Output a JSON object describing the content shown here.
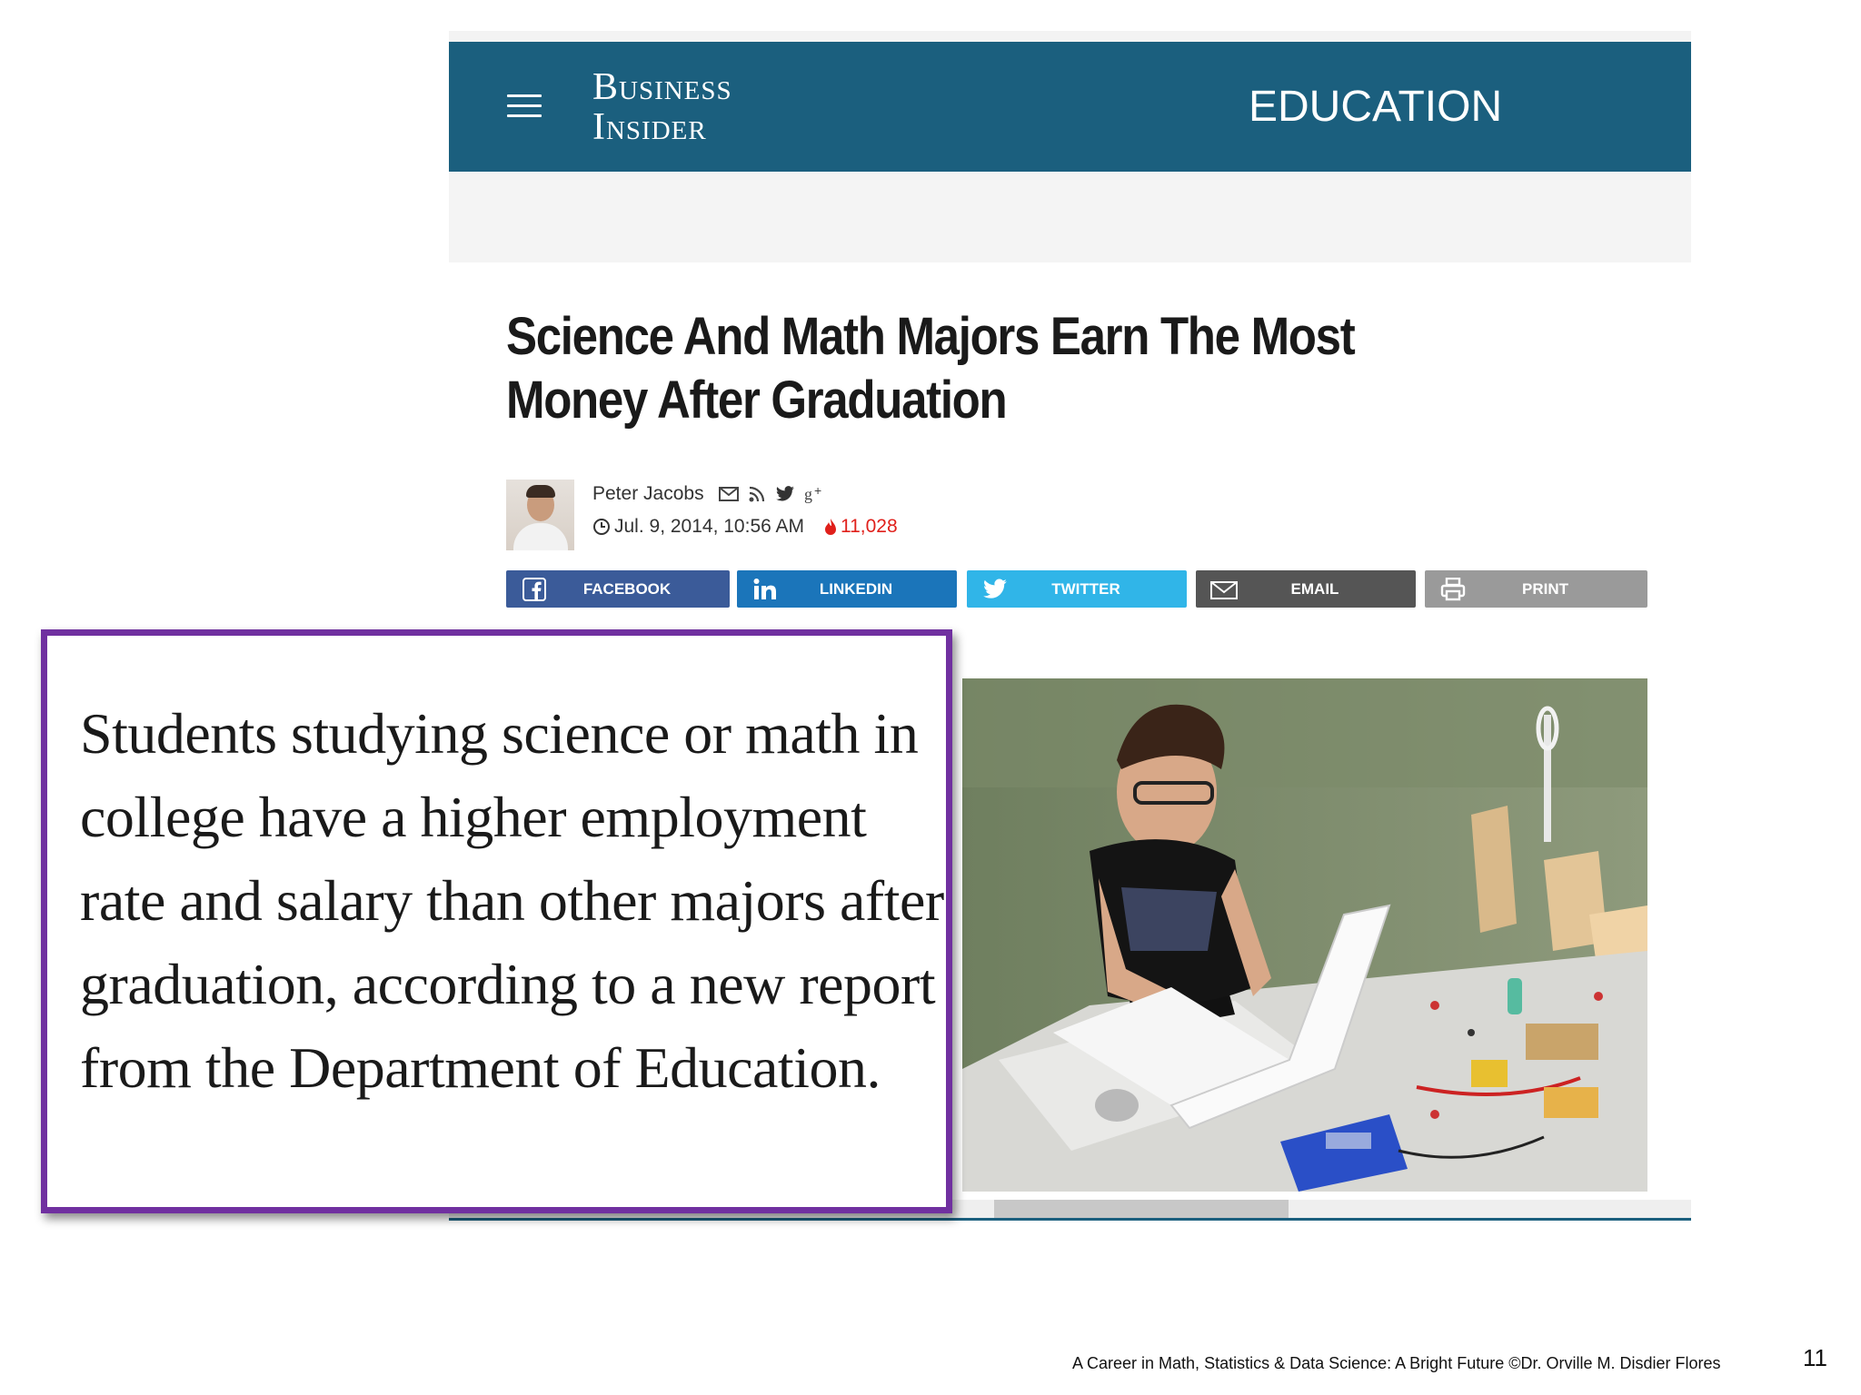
{
  "header": {
    "logo_line1": "Business",
    "logo_line2": "Insider",
    "section": "EDUCATION"
  },
  "article": {
    "title": "Science And Math Majors Earn The Most Money After Graduation",
    "author": "Peter Jacobs",
    "date": "Jul. 9, 2014, 10:56 AM",
    "views": "11,028"
  },
  "share": {
    "facebook": "FACEBOOK",
    "linkedin": "LINKEDIN",
    "twitter": "TWITTER",
    "email": "EMAIL",
    "print": "PRINT"
  },
  "quote": {
    "text": "Students studying science or math in college have a higher employment rate and salary than other majors after graduation, according to a new report from the Department of Education."
  },
  "slide": {
    "footer": "A Career in Math, Statistics & Data Science: A Bright Future ©Dr. Orville M. Disdier Flores",
    "page_number": "11"
  },
  "colors": {
    "header_bg": "#1b5f7e",
    "quote_border": "#7030a0",
    "views_red": "#e0201b",
    "facebook": "#3b5b99",
    "linkedin": "#1b75ba",
    "twitter": "#30b5e8",
    "email": "#555555",
    "print": "#9a9a9a"
  },
  "icons": [
    "menu-icon",
    "mail-icon",
    "rss-icon",
    "twitter-icon",
    "google-plus-icon",
    "clock-icon",
    "flame-icon",
    "facebook-icon",
    "linkedin-icon",
    "envelope-icon",
    "printer-icon"
  ]
}
